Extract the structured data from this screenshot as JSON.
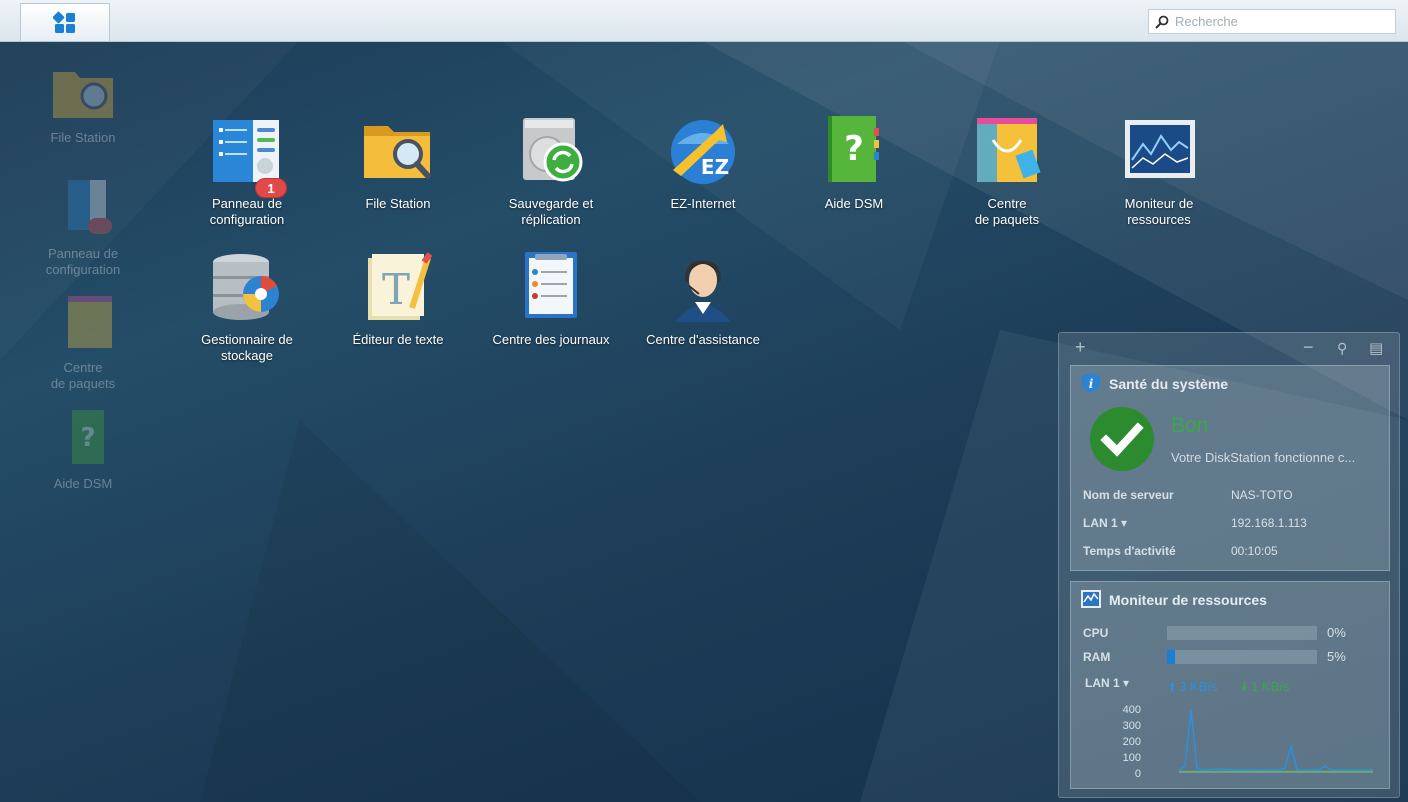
{
  "search": {
    "placeholder": "Recherche"
  },
  "desktop_shortcuts": [
    {
      "label": "File Station",
      "icon": "file-station-icon"
    },
    {
      "label": "Panneau de\nconfiguration",
      "icon": "control-panel-icon",
      "badge": "1"
    },
    {
      "label": "Centre\nde paquets",
      "icon": "package-center-icon"
    },
    {
      "label": "Aide DSM",
      "icon": "dsm-help-icon"
    }
  ],
  "apps": [
    {
      "label": "Panneau de\nconfiguration",
      "icon": "control-panel-icon",
      "badge": "1"
    },
    {
      "label": "File Station",
      "icon": "file-station-icon"
    },
    {
      "label": "Sauvegarde et\nréplication",
      "icon": "backup-replication-icon"
    },
    {
      "label": "EZ-Internet",
      "icon": "ez-internet-icon"
    },
    {
      "label": "Aide DSM",
      "icon": "dsm-help-icon"
    },
    {
      "label": "Centre\nde paquets",
      "icon": "package-center-icon"
    },
    {
      "label": "Moniteur de\nressources",
      "icon": "resource-monitor-icon"
    },
    {
      "label": "Gestionnaire de\nstockage",
      "icon": "storage-manager-icon"
    },
    {
      "label": "Éditeur de texte",
      "icon": "text-editor-icon"
    },
    {
      "label": "Centre des journaux",
      "icon": "log-center-icon"
    },
    {
      "label": "Centre d'assistance",
      "icon": "support-center-icon"
    }
  ],
  "widgets": {
    "health": {
      "title": "Santé du système",
      "status": "Bon",
      "description": "Votre DiskStation fonctionne c...",
      "rows": [
        {
          "label": "Nom de serveur",
          "value": "NAS-TOTO"
        },
        {
          "label": "LAN 1 ▾",
          "value": "192.168.1.113"
        },
        {
          "label": "Temps d'activité",
          "value": "00:10:05"
        }
      ]
    },
    "resources": {
      "title": "Moniteur de ressources",
      "cpu_label": "CPU",
      "cpu_value": "0%",
      "cpu_fraction": 0.0,
      "ram_label": "RAM",
      "ram_value": "5%",
      "ram_fraction": 0.05,
      "lan_label": "LAN 1 ▾",
      "upload": "3 KB/s",
      "download": "1 KB/s",
      "y_ticks": [
        "400",
        "300",
        "200",
        "100",
        "0"
      ]
    }
  },
  "colors": {
    "accent": "#1a7fd0",
    "status_ok": "#3aa84a",
    "badge": "#e04a4a"
  }
}
